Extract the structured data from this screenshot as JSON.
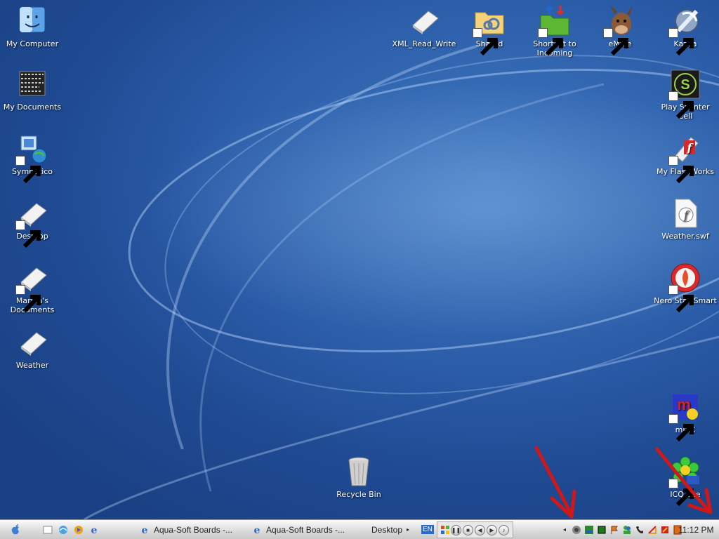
{
  "desktop": {
    "icons": [
      {
        "label": "My Computer"
      },
      {
        "label": "My Documents"
      },
      {
        "label": "Sympatico"
      },
      {
        "label": "Desktop"
      },
      {
        "label": "Marina's Documents"
      },
      {
        "label": "Weather"
      },
      {
        "label": "XML_Read_Write"
      },
      {
        "label": "Shared"
      },
      {
        "label": "Shortcut to Incoming"
      },
      {
        "label": "eMule"
      },
      {
        "label": "Kazaa"
      },
      {
        "label": "Play Splinter Cell"
      },
      {
        "label": "My FlashWorks"
      },
      {
        "label": "Weather.swf"
      },
      {
        "label": "Nero StartSmart"
      },
      {
        "label": "mIRC"
      },
      {
        "label": "ICQ Lite"
      },
      {
        "label": "Recycle Bin"
      }
    ]
  },
  "taskbar": {
    "tasks": [
      "Aqua-Soft Boards -...",
      "Aqua-Soft Boards -..."
    ],
    "desktop_label": "Desktop",
    "language": "EN",
    "clock": "11:12 PM",
    "tray_icons": [
      "network-icon",
      "lite-icon",
      "green-square-icon",
      "flag-icon",
      "msn-icon",
      "phone-icon",
      "wireless-icon",
      "tool-icon",
      "shield-icon"
    ]
  },
  "colors": {
    "desktop_blue": "#2b5ca8",
    "annotation_red": "#d01818"
  }
}
